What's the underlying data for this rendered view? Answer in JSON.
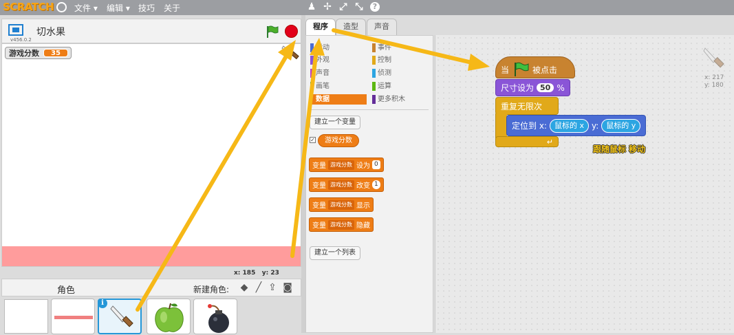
{
  "topbar": {
    "logo": "SCRATCH",
    "menus": [
      "文件 ▾",
      "编辑 ▾",
      "技巧",
      "关于"
    ],
    "tools": [
      {
        "icon": "duplicate-stamp-icon",
        "glyph": "♟"
      },
      {
        "icon": "cut-icon",
        "glyph": "✢"
      },
      {
        "icon": "grow-icon",
        "glyph": "⤢"
      },
      {
        "icon": "shrink-icon",
        "glyph": "⤡"
      },
      {
        "icon": "help-icon",
        "glyph": "?"
      }
    ]
  },
  "stage": {
    "project_title": "切水果",
    "version": "v456.0.2",
    "variable_monitor": {
      "name": "游戏分数",
      "value": "35"
    },
    "coords": {
      "x_label": "x:",
      "x": "185",
      "y_label": "y:",
      "y": "23"
    }
  },
  "sprites": {
    "label": "角色",
    "new_sprite_label": "新建角色:",
    "new_sprite_icons": [
      "paint-icon",
      "brush-icon",
      "upload-icon",
      "camera-icon"
    ],
    "items": [
      {
        "name": "stage-thumb"
      },
      {
        "name": "pink-line-sprite"
      },
      {
        "name": "knife-sprite",
        "selected": true
      },
      {
        "name": "apple-sprite"
      },
      {
        "name": "bomb-sprite"
      }
    ]
  },
  "tabs": [
    "程序",
    "造型",
    "声音"
  ],
  "palette": {
    "categories_left": [
      {
        "label": "运动",
        "color": "#4a6cd4"
      },
      {
        "label": "外观",
        "color": "#8a55d7"
      },
      {
        "label": "声音",
        "color": "#bb42c3"
      },
      {
        "label": "画笔",
        "color": "#0e9a6c"
      },
      {
        "label": "数据",
        "color": "#ee7d16",
        "active": true
      }
    ],
    "categories_right": [
      {
        "label": "事件",
        "color": "#c88330"
      },
      {
        "label": "控制",
        "color": "#e1a91a"
      },
      {
        "label": "侦测",
        "color": "#2ca5e2"
      },
      {
        "label": "运算",
        "color": "#5cb712"
      },
      {
        "label": "更多积木",
        "color": "#632d99"
      }
    ],
    "make_variable": "建立一个变量",
    "variable_reporter": "游戏分数",
    "blocks": [
      {
        "prefix": "变量",
        "var": "游戏分数",
        "action": "设为",
        "value": "0"
      },
      {
        "prefix": "变量",
        "var": "游戏分数",
        "action": "改变",
        "value": "1"
      },
      {
        "prefix": "变量",
        "var": "游戏分数",
        "action": "显示",
        "value": ""
      },
      {
        "prefix": "变量",
        "var": "游戏分数",
        "action": "隐藏",
        "value": ""
      }
    ],
    "make_list": "建立一个列表"
  },
  "script": {
    "hat_when": "当",
    "hat_clicked": "被点击",
    "set_size_label": "尺寸设为",
    "set_size_value": "50",
    "set_size_unit": "%",
    "forever": "重复无限次",
    "goto_label": "定位到 x:",
    "mouse_x": "鼠标的 x",
    "y_label": "y:",
    "mouse_y": "鼠标的 y",
    "annotation": "跟随鼠标 移动",
    "sprite_x": "x: 217",
    "sprite_y": "y: 180"
  },
  "colors": {
    "arrow": "#f6b817",
    "data": "#ee7d16",
    "events": "#c88330",
    "looks": "#8a55d7",
    "control": "#e1a91a",
    "motion": "#4a6cd4",
    "sensing": "#2ca5e2"
  }
}
